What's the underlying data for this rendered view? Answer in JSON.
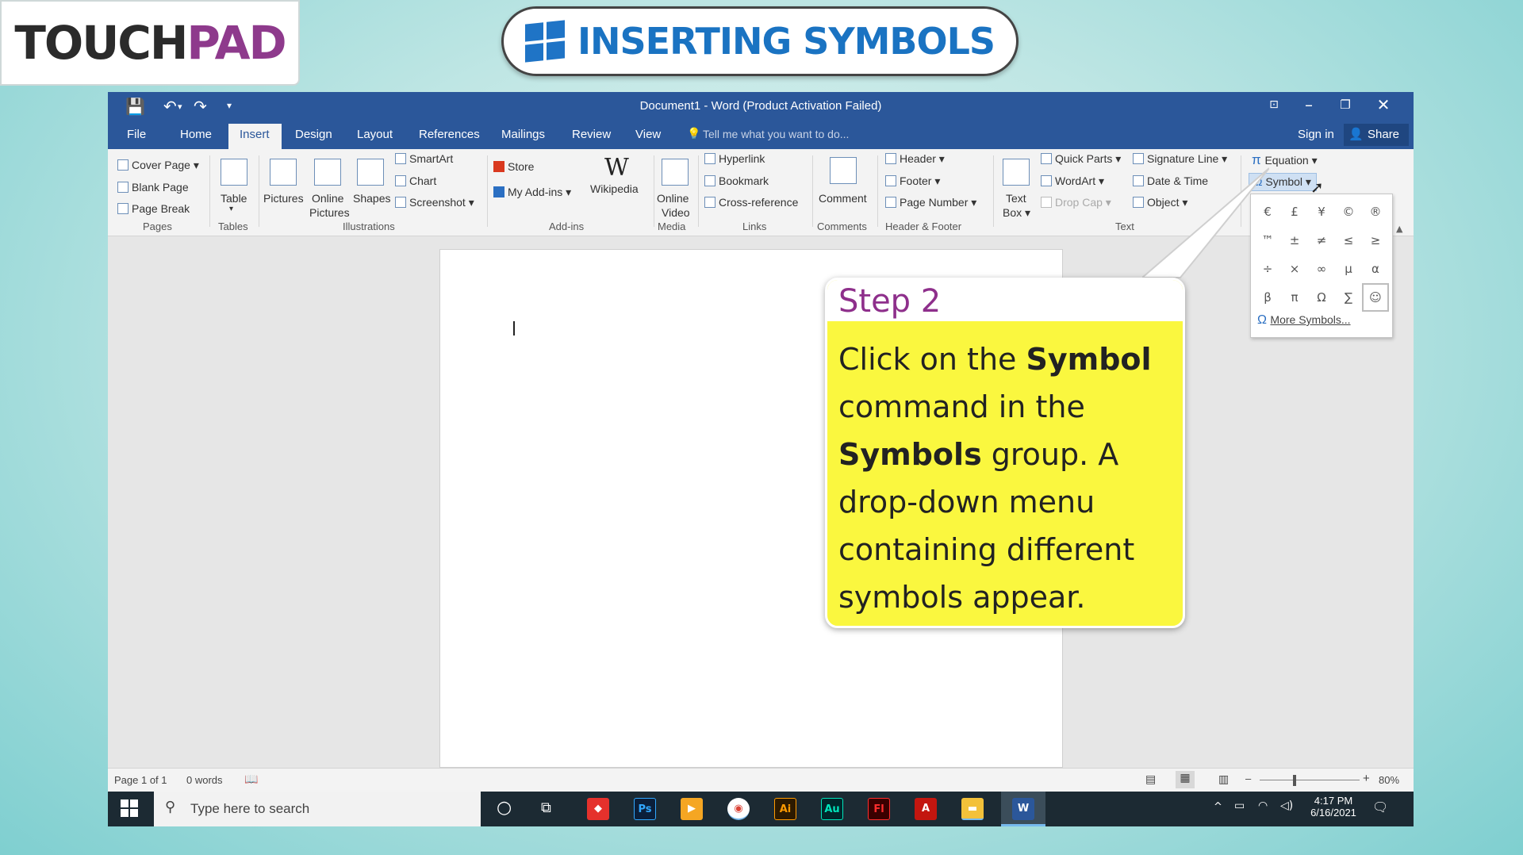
{
  "brand": {
    "logo_part1": "TOUCH",
    "logo_part2": "PAD"
  },
  "title": "INSERTING SYMBOLS",
  "window": {
    "title": "Document1 - Word (Product Activation Failed)",
    "tell_me": "Tell me what you want to do...",
    "sign_in": "Sign in",
    "share": "Share"
  },
  "tabs": [
    "File",
    "Home",
    "Insert",
    "Design",
    "Layout",
    "References",
    "Mailings",
    "Review",
    "View"
  ],
  "ribbon": {
    "pages": {
      "cover_page": "Cover Page",
      "blank_page": "Blank Page",
      "page_break": "Page Break",
      "group": "Pages"
    },
    "tables": {
      "table": "Table",
      "group": "Tables"
    },
    "illustrations": {
      "pictures": "Pictures",
      "online": "Online",
      "pictures2": "Pictures",
      "shapes": "Shapes",
      "smartart": "SmartArt",
      "chart": "Chart",
      "screenshot": "Screenshot",
      "group": "Illustrations"
    },
    "addins": {
      "store": "Store",
      "my_addins": "My Add-ins",
      "wikipedia": "Wikipedia",
      "group": "Add-ins"
    },
    "media": {
      "online": "Online",
      "video": "Video",
      "group": "Media"
    },
    "links": {
      "hyperlink": "Hyperlink",
      "bookmark": "Bookmark",
      "cross_reference": "Cross-reference",
      "group": "Links"
    },
    "comments": {
      "comment": "Comment",
      "group": "Comments"
    },
    "header_footer": {
      "header": "Header",
      "footer": "Footer",
      "page_number": "Page Number",
      "group": "Header & Footer"
    },
    "text": {
      "text": "Text",
      "box": "Box",
      "quick_parts": "Quick Parts",
      "wordart": "WordArt",
      "drop_cap": "Drop Cap",
      "signature_line": "Signature Line",
      "date_time": "Date & Time",
      "object": "Object",
      "group": "Text"
    },
    "symbols": {
      "equation": "Equation",
      "symbol": "Symbol"
    }
  },
  "symbol_menu": {
    "symbols": [
      "€",
      "£",
      "¥",
      "©",
      "®",
      "™",
      "±",
      "≠",
      "≤",
      "≥",
      "÷",
      "×",
      "∞",
      "µ",
      "α",
      "β",
      "π",
      "Ω",
      "∑",
      "☺"
    ],
    "more": "More Symbols..."
  },
  "callout": {
    "step": "Step 2",
    "t1": "Click on the ",
    "b1": "Symbol",
    "t2": " command in the ",
    "b2": "Symbols",
    "t3": " group. A drop-down menu containing different symbols appear."
  },
  "status": {
    "page": "Page 1 of 1",
    "words": "0 words",
    "zoom": "80%"
  },
  "taskbar": {
    "search_placeholder": "Type here to search",
    "time": "4:17 PM",
    "date": "6/16/2021",
    "apps": [
      "Ps",
      "Ai",
      "Au",
      "Fl"
    ]
  },
  "colors": {
    "word_blue": "#2b579a",
    "callout_yellow": "#faf73f",
    "step_purple": "#8e2f8b",
    "title_blue": "#1a73c2"
  }
}
